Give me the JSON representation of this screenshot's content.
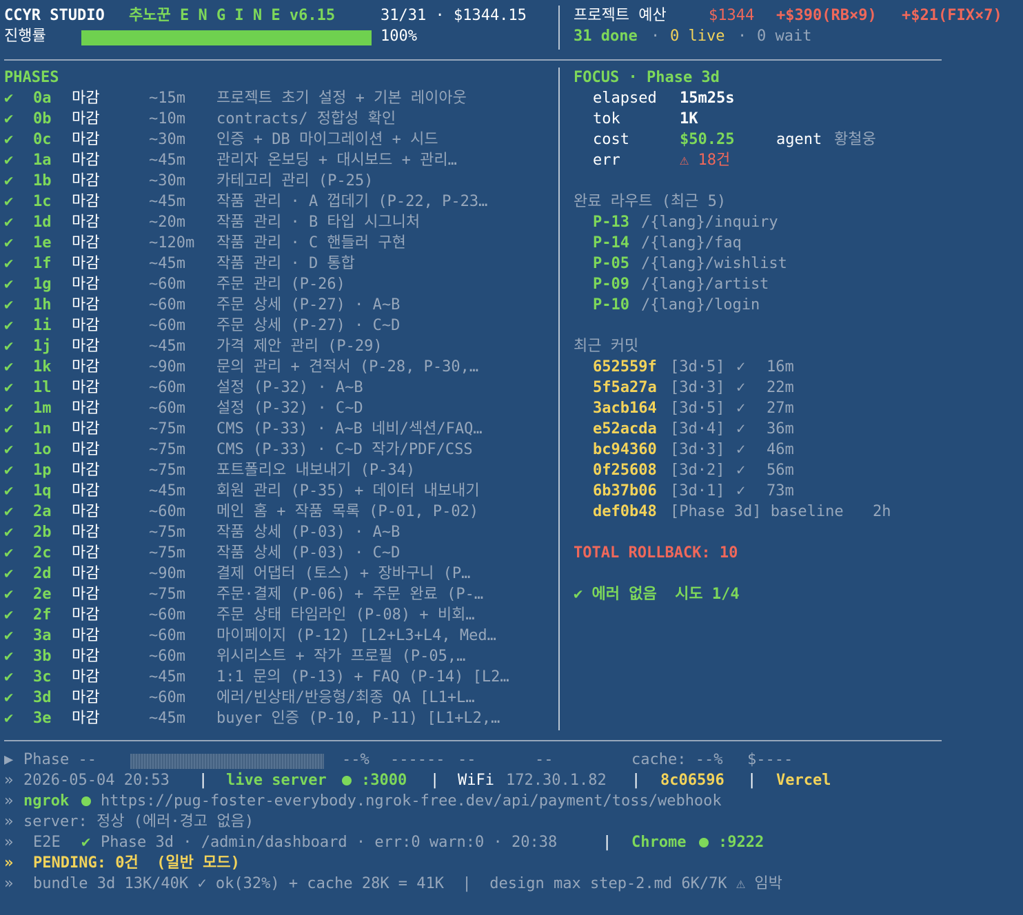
{
  "header": {
    "studio": "CCYR STUDIO",
    "engine": "추노꾼 E N G I N E v6.15",
    "count": "31/31 · $1344.15",
    "progress_label": "진행률",
    "progress_percent": "100%",
    "progress_value": 1.0,
    "budget_label": "프로젝트 예산",
    "budget_amount": "$1344",
    "budget_rb": "+$390(RB×9)",
    "budget_fix": "+$21(FIX×7)",
    "done": "31 done",
    "live": "0 live",
    "wait": "0 wait",
    "sep": "·"
  },
  "phases": {
    "title": "PHASES",
    "check": "✔",
    "rows": [
      {
        "id": "0a",
        "status": "마감",
        "est": "~15m",
        "desc": "프로젝트 초기 설정 + 기본 레이아웃"
      },
      {
        "id": "0b",
        "status": "마감",
        "est": "~10m",
        "desc": "contracts/ 정합성 확인"
      },
      {
        "id": "0c",
        "status": "마감",
        "est": "~30m",
        "desc": "인증 + DB 마이그레이션 + 시드"
      },
      {
        "id": "1a",
        "status": "마감",
        "est": "~45m",
        "desc": "관리자 온보딩 + 대시보드 + 관리…"
      },
      {
        "id": "1b",
        "status": "마감",
        "est": "~30m",
        "desc": "카테고리 관리 (P-25)"
      },
      {
        "id": "1c",
        "status": "마감",
        "est": "~45m",
        "desc": "작품 관리 · A 껍데기 (P-22, P-23…"
      },
      {
        "id": "1d",
        "status": "마감",
        "est": "~20m",
        "desc": "작품 관리 · B 타입 시그니처"
      },
      {
        "id": "1e",
        "status": "마감",
        "est": "~120m",
        "desc": "작품 관리 · C 핸들러 구현"
      },
      {
        "id": "1f",
        "status": "마감",
        "est": "~45m",
        "desc": "작품 관리 · D 통합"
      },
      {
        "id": "1g",
        "status": "마감",
        "est": "~60m",
        "desc": "주문 관리 (P-26)"
      },
      {
        "id": "1h",
        "status": "마감",
        "est": "~60m",
        "desc": "주문 상세 (P-27) · A~B"
      },
      {
        "id": "1i",
        "status": "마감",
        "est": "~60m",
        "desc": "주문 상세 (P-27) · C~D"
      },
      {
        "id": "1j",
        "status": "마감",
        "est": "~45m",
        "desc": "가격 제안 관리 (P-29)"
      },
      {
        "id": "1k",
        "status": "마감",
        "est": "~90m",
        "desc": "문의 관리 + 견적서 (P-28, P-30,…"
      },
      {
        "id": "1l",
        "status": "마감",
        "est": "~60m",
        "desc": "설정 (P-32) · A~B"
      },
      {
        "id": "1m",
        "status": "마감",
        "est": "~60m",
        "desc": "설정 (P-32) · C~D"
      },
      {
        "id": "1n",
        "status": "마감",
        "est": "~75m",
        "desc": "CMS (P-33) · A~B 네비/섹션/FAQ…"
      },
      {
        "id": "1o",
        "status": "마감",
        "est": "~75m",
        "desc": "CMS (P-33) · C~D 작가/PDF/CSS"
      },
      {
        "id": "1p",
        "status": "마감",
        "est": "~75m",
        "desc": "포트폴리오 내보내기 (P-34)"
      },
      {
        "id": "1q",
        "status": "마감",
        "est": "~45m",
        "desc": "회원 관리 (P-35) + 데이터 내보내기"
      },
      {
        "id": "2a",
        "status": "마감",
        "est": "~60m",
        "desc": "메인 홈 + 작품 목록 (P-01, P-02)"
      },
      {
        "id": "2b",
        "status": "마감",
        "est": "~75m",
        "desc": "작품 상세 (P-03) · A~B"
      },
      {
        "id": "2c",
        "status": "마감",
        "est": "~75m",
        "desc": "작품 상세 (P-03) · C~D"
      },
      {
        "id": "2d",
        "status": "마감",
        "est": "~90m",
        "desc": "결제 어댑터 (토스) + 장바구니 (P…"
      },
      {
        "id": "2e",
        "status": "마감",
        "est": "~75m",
        "desc": "주문·결제 (P-06) + 주문 완료 (P-…"
      },
      {
        "id": "2f",
        "status": "마감",
        "est": "~60m",
        "desc": "주문 상태 타임라인 (P-08) + 비회…"
      },
      {
        "id": "3a",
        "status": "마감",
        "est": "~60m",
        "desc": "마이페이지 (P-12) [L2+L3+L4, Med…"
      },
      {
        "id": "3b",
        "status": "마감",
        "est": "~60m",
        "desc": "위시리스트 + 작가 프로필 (P-05,…"
      },
      {
        "id": "3c",
        "status": "마감",
        "est": "~45m",
        "desc": "1:1 문의 (P-13) + FAQ (P-14) [L2…"
      },
      {
        "id": "3d",
        "status": "마감",
        "est": "~60m",
        "desc": "에러/빈상태/반응형/최종 QA [L1+L…"
      },
      {
        "id": "3e",
        "status": "마감",
        "est": "~45m",
        "desc": "buyer 인증 (P-10, P-11) [L1+L2,…"
      }
    ]
  },
  "focus": {
    "title": "FOCUS · Phase 3d",
    "elapsed_label": "elapsed",
    "elapsed": "15m25s",
    "tok_label": "tok",
    "tok": "1K",
    "cost_label": "cost",
    "cost": "$50.25",
    "agent_label": "agent",
    "agent": "황철웅",
    "err_label": "err",
    "err": "⚠ 18건"
  },
  "routes": {
    "title": "완료 라우트 (최근 5)",
    "items": [
      {
        "id": "P-13",
        "path": "/{lang}/inquiry"
      },
      {
        "id": "P-14",
        "path": "/{lang}/faq"
      },
      {
        "id": "P-05",
        "path": "/{lang}/wishlist"
      },
      {
        "id": "P-09",
        "path": "/{lang}/artist"
      },
      {
        "id": "P-10",
        "path": "/{lang}/login"
      }
    ]
  },
  "commits": {
    "title": "최근 커밋",
    "items": [
      {
        "hash": "652559f",
        "tag": "[3d·5]",
        "mark": "✓",
        "age": "16m"
      },
      {
        "hash": "5f5a27a",
        "tag": "[3d·3]",
        "mark": "✓",
        "age": "22m"
      },
      {
        "hash": "3acb164",
        "tag": "[3d·5]",
        "mark": "✓",
        "age": "27m"
      },
      {
        "hash": "e52acda",
        "tag": "[3d·4]",
        "mark": "✓",
        "age": "36m"
      },
      {
        "hash": "bc94360",
        "tag": "[3d·3]",
        "mark": "✓",
        "age": "46m"
      },
      {
        "hash": "0f25608",
        "tag": "[3d·2]",
        "mark": "✓",
        "age": "56m"
      },
      {
        "hash": "6b37b06",
        "tag": "[3d·1]",
        "mark": "✓",
        "age": "73m"
      }
    ],
    "baseline_hash": "def0b48",
    "baseline_label": "[Phase 3d] baseline",
    "baseline_age": "2h"
  },
  "rollback": "TOTAL ROLLBACK: 10",
  "status_ok": "✔ 에러 없음  시도 1/4",
  "footer": {
    "phase_line": {
      "arrow": "▶",
      "phase": "Phase --",
      "pct": "--%",
      "dash1": "------",
      "dash2": "--",
      "dash3": "--",
      "cache": "cache: --%",
      "cost": "$----"
    },
    "prompt": "»",
    "line2": {
      "datetime": "2026-05-04 20:53",
      "live_server": "live server",
      "port": ":3000",
      "wifi_label": "WiFi",
      "ip": "172.30.1.82",
      "commit": "8c06596",
      "host": "Vercel",
      "sep": "|"
    },
    "line3": {
      "ngrok": "ngrok",
      "url": "https://pug-foster-everybody.ngrok-free.dev/api/payment/toss/webhook"
    },
    "line4": "server: 정상 (에러·경고 없음)",
    "line5": {
      "e2e": "E2E",
      "mark": "✔",
      "text": "Phase 3d · /admin/dashboard · err:0 warn:0 · 20:38",
      "sep": "|",
      "chrome": "Chrome",
      "port": ":9222"
    },
    "line6": "PENDING: 0건  (일반 모드)",
    "line7": "bundle 3d 13K/40K ✓ ok(32%) + cache 28K = 41K  |  design max step-2.md 6K/7K ⚠ 임박"
  },
  "colors": {
    "background": "#254c78",
    "green": "#7ed85a",
    "yellow": "#f3d35a",
    "red": "#f0685a",
    "white": "#ffffff",
    "dim": "#97a7bb"
  }
}
